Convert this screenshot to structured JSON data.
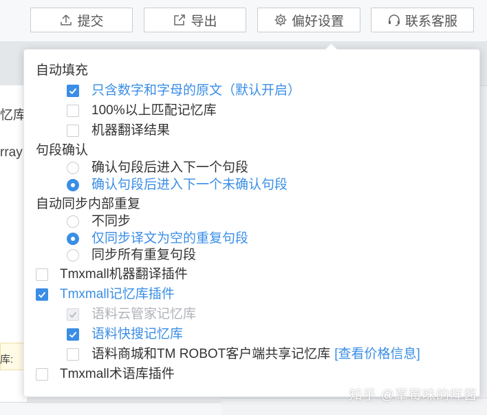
{
  "toolbar": {
    "submit_label": "提交",
    "export_label": "导出",
    "preferences_label": "偏好设置",
    "support_label": "联系客服"
  },
  "background": {
    "fragment_1": "忆库",
    "fragment_2": "rray",
    "fragment_3": "库:"
  },
  "watermark": "知乎 @草莓味的咩酱",
  "colors": {
    "accent": "#3a8ee6",
    "disabled": "#b0b3b8",
    "text": "#333333"
  },
  "preferences": {
    "auto_fill": {
      "title": "自动填充",
      "options": [
        {
          "label": "只含数字和字母的原文（默认开启）",
          "checked": true
        },
        {
          "label": "100%以上匹配记忆库",
          "checked": false
        },
        {
          "label": "机器翻译结果",
          "checked": false
        }
      ]
    },
    "segment_confirm": {
      "title": "句段确认",
      "options": [
        {
          "label": "确认句段后进入下一个句段",
          "selected": false
        },
        {
          "label": "确认句段后进入下一个未确认句段",
          "selected": true
        }
      ]
    },
    "auto_sync": {
      "title": "自动同步内部重复",
      "options": [
        {
          "label": "不同步",
          "selected": false
        },
        {
          "label": "仅同步译文为空的重复句段",
          "selected": true
        },
        {
          "label": "同步所有重复句段",
          "selected": false
        }
      ]
    },
    "plugins": {
      "mt_plugin": {
        "label": "Tmxmall机器翻译插件",
        "checked": false
      },
      "tm_plugin": {
        "label": "Tmxmall记忆库插件",
        "checked": true,
        "children": [
          {
            "label": "语料云管家记忆库",
            "checked": true,
            "disabled": true
          },
          {
            "label": "语料快搜记忆库",
            "checked": true
          },
          {
            "label": "语料商城和TM ROBOT客户端共享记忆库",
            "checked": false,
            "link": "[查看价格信息]"
          }
        ]
      },
      "term_plugin": {
        "label": "Tmxmall术语库插件",
        "checked": false
      }
    }
  }
}
